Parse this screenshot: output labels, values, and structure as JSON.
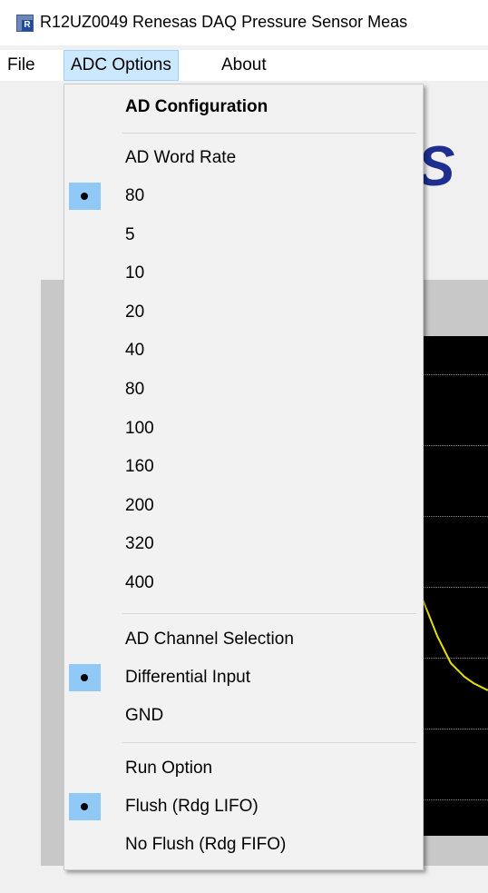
{
  "window": {
    "title": "R12UZ0049 Renesas DAQ Pressure Sensor Meas"
  },
  "menubar": {
    "file": "File",
    "adc_options": "ADC Options",
    "about": "About"
  },
  "dropdown": {
    "ad_configuration": "AD Configuration",
    "word_rate": {
      "header": "AD Word Rate",
      "items": [
        {
          "label": "80",
          "checked": true
        },
        {
          "label": "5",
          "checked": false
        },
        {
          "label": "10",
          "checked": false
        },
        {
          "label": "20",
          "checked": false
        },
        {
          "label": "40",
          "checked": false
        },
        {
          "label": "80",
          "checked": false
        },
        {
          "label": "100",
          "checked": false
        },
        {
          "label": "160",
          "checked": false
        },
        {
          "label": "200",
          "checked": false
        },
        {
          "label": "320",
          "checked": false
        },
        {
          "label": "400",
          "checked": false
        }
      ]
    },
    "channel": {
      "header": "AD Channel Selection",
      "items": [
        {
          "label": "Differential Input",
          "checked": true
        },
        {
          "label": "GND",
          "checked": false
        }
      ]
    },
    "run_option": {
      "header": "Run Option",
      "items": [
        {
          "label": "Flush (Rdg LIFO)",
          "checked": true
        },
        {
          "label": "No Flush (Rdg FIFO)",
          "checked": false
        }
      ]
    }
  },
  "colors": {
    "check_highlight": "#90c8f6",
    "menu_highlight": "#cce8ff",
    "trace": "#e5e000"
  }
}
